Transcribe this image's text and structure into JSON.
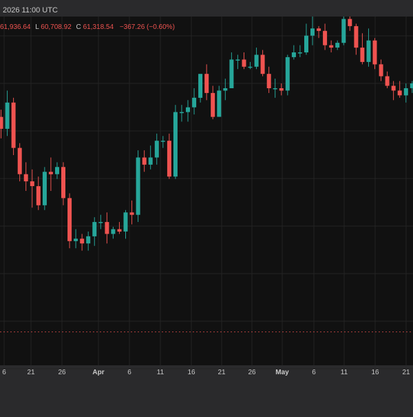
{
  "header": {
    "datetime": "2026 11:00 UTC",
    "ohlc_open": "61,936.64",
    "ohlc_low_label": "L",
    "ohlc_low": "60,708.92",
    "ohlc_close_label": "C",
    "ohlc_close": "61,318.54",
    "change": "−367.26 (−0.60%)"
  },
  "colors": {
    "background": "#111111",
    "frame": "#2a2a2c",
    "grid": "#242424",
    "up": "#26a69a",
    "down": "#ef5350",
    "axis_text": "#c9c9c9",
    "header_text": "#c9c9c9",
    "price_line": "#ef5350"
  },
  "chart_data": {
    "type": "candlestick",
    "x_tick_labels": [
      "6",
      "21",
      "26",
      "Apr",
      "6",
      "11",
      "16",
      "21",
      "26",
      "May",
      "6",
      "11",
      "16",
      "21"
    ],
    "y_range": [
      56200,
      70800
    ],
    "grid": true,
    "last_price_line": 57600,
    "candles": [
      {
        "d": "Mar 16",
        "o": 66600,
        "h": 66900,
        "l": 65700,
        "c": 66100
      },
      {
        "d": "Mar 17",
        "o": 66100,
        "h": 67700,
        "l": 65800,
        "c": 67200
      },
      {
        "d": "Mar 18",
        "o": 67200,
        "h": 67400,
        "l": 65000,
        "c": 65300
      },
      {
        "d": "Mar 19",
        "o": 65300,
        "h": 65500,
        "l": 63900,
        "c": 64200
      },
      {
        "d": "Mar 20",
        "o": 64200,
        "h": 64700,
        "l": 63500,
        "c": 63900
      },
      {
        "d": "Mar 21",
        "o": 63900,
        "h": 64400,
        "l": 62800,
        "c": 63700
      },
      {
        "d": "Mar 22",
        "o": 63700,
        "h": 64100,
        "l": 62700,
        "c": 62900
      },
      {
        "d": "Mar 23",
        "o": 62900,
        "h": 64500,
        "l": 62700,
        "c": 64300
      },
      {
        "d": "Mar 24",
        "o": 64300,
        "h": 64900,
        "l": 63500,
        "c": 64200
      },
      {
        "d": "Mar 25",
        "o": 64200,
        "h": 64700,
        "l": 64000,
        "c": 64500
      },
      {
        "d": "Mar 26",
        "o": 64500,
        "h": 64700,
        "l": 62900,
        "c": 63200
      },
      {
        "d": "Mar 27",
        "o": 63200,
        "h": 63400,
        "l": 61100,
        "c": 61400
      },
      {
        "d": "Mar 28",
        "o": 61400,
        "h": 61900,
        "l": 61100,
        "c": 61500
      },
      {
        "d": "Mar 29",
        "o": 61500,
        "h": 61700,
        "l": 61000,
        "c": 61300
      },
      {
        "d": "Mar 30",
        "o": 61300,
        "h": 61800,
        "l": 61000,
        "c": 61600
      },
      {
        "d": "Mar 31",
        "o": 61600,
        "h": 62400,
        "l": 61200,
        "c": 62200
      },
      {
        "d": "Apr 1",
        "o": 62200,
        "h": 62500,
        "l": 61900,
        "c": 62200
      },
      {
        "d": "Apr 2",
        "o": 62200,
        "h": 62600,
        "l": 61300,
        "c": 61700
      },
      {
        "d": "Apr 3",
        "o": 61700,
        "h": 62000,
        "l": 61500,
        "c": 61900
      },
      {
        "d": "Apr 4",
        "o": 61900,
        "h": 62200,
        "l": 61700,
        "c": 61800
      },
      {
        "d": "Apr 5",
        "o": 61800,
        "h": 62700,
        "l": 61500,
        "c": 62600
      },
      {
        "d": "Apr 6",
        "o": 62600,
        "h": 63100,
        "l": 62100,
        "c": 62500
      },
      {
        "d": "Apr 7",
        "o": 62500,
        "h": 65200,
        "l": 62200,
        "c": 64900
      },
      {
        "d": "Apr 8",
        "o": 64900,
        "h": 65200,
        "l": 64300,
        "c": 64600
      },
      {
        "d": "Apr 9",
        "o": 64600,
        "h": 65400,
        "l": 64400,
        "c": 64900
      },
      {
        "d": "Apr 10",
        "o": 64900,
        "h": 65900,
        "l": 64600,
        "c": 65600
      },
      {
        "d": "Apr 11",
        "o": 65600,
        "h": 65800,
        "l": 65300,
        "c": 65600
      },
      {
        "d": "Apr 12",
        "o": 65600,
        "h": 65900,
        "l": 64000,
        "c": 64100
      },
      {
        "d": "Apr 13",
        "o": 64100,
        "h": 67100,
        "l": 64000,
        "c": 66800
      },
      {
        "d": "Apr 14",
        "o": 66800,
        "h": 67100,
        "l": 66400,
        "c": 66800
      },
      {
        "d": "Apr 15",
        "o": 66800,
        "h": 67300,
        "l": 66400,
        "c": 67000
      },
      {
        "d": "Apr 16",
        "o": 67000,
        "h": 67800,
        "l": 66700,
        "c": 67400
      },
      {
        "d": "Apr 17",
        "o": 67400,
        "h": 68200,
        "l": 67200,
        "c": 68400
      },
      {
        "d": "Apr 18",
        "o": 68400,
        "h": 68800,
        "l": 67300,
        "c": 67600
      },
      {
        "d": "Apr 19",
        "o": 67600,
        "h": 67900,
        "l": 66500,
        "c": 66600
      },
      {
        "d": "Apr 20",
        "o": 66600,
        "h": 67900,
        "l": 66600,
        "c": 67700
      },
      {
        "d": "Apr 21",
        "o": 67700,
        "h": 68200,
        "l": 67300,
        "c": 67800
      },
      {
        "d": "Apr 22",
        "o": 67800,
        "h": 69300,
        "l": 67800,
        "c": 69000
      },
      {
        "d": "Apr 23",
        "o": 69000,
        "h": 69200,
        "l": 68600,
        "c": 69000
      },
      {
        "d": "Apr 24",
        "o": 69000,
        "h": 69300,
        "l": 68600,
        "c": 68700
      },
      {
        "d": "Apr 25",
        "o": 68700,
        "h": 68900,
        "l": 68600,
        "c": 68700
      },
      {
        "d": "Apr 26",
        "o": 68700,
        "h": 69500,
        "l": 68600,
        "c": 69200
      },
      {
        "d": "Apr 27",
        "o": 69200,
        "h": 69400,
        "l": 68300,
        "c": 68400
      },
      {
        "d": "Apr 28",
        "o": 68400,
        "h": 68700,
        "l": 67600,
        "c": 67800
      },
      {
        "d": "Apr 29",
        "o": 67800,
        "h": 68200,
        "l": 67400,
        "c": 67800
      },
      {
        "d": "Apr 30",
        "o": 67800,
        "h": 68000,
        "l": 67500,
        "c": 67700
      },
      {
        "d": "May 1",
        "o": 67700,
        "h": 69200,
        "l": 67500,
        "c": 69100
      },
      {
        "d": "May 2",
        "o": 69100,
        "h": 69600,
        "l": 69000,
        "c": 69300
      },
      {
        "d": "May 3",
        "o": 69300,
        "h": 69600,
        "l": 69100,
        "c": 69300
      },
      {
        "d": "May 4",
        "o": 69300,
        "h": 70500,
        "l": 69200,
        "c": 70000
      },
      {
        "d": "May 5",
        "o": 70000,
        "h": 70800,
        "l": 69600,
        "c": 70300
      },
      {
        "d": "May 6",
        "o": 70300,
        "h": 70400,
        "l": 69900,
        "c": 70200
      },
      {
        "d": "May 7",
        "o": 70200,
        "h": 70500,
        "l": 69400,
        "c": 69600
      },
      {
        "d": "May 8",
        "o": 69600,
        "h": 69800,
        "l": 69300,
        "c": 69500
      },
      {
        "d": "May 9",
        "o": 69500,
        "h": 69800,
        "l": 69400,
        "c": 69700
      },
      {
        "d": "May 10",
        "o": 69700,
        "h": 70800,
        "l": 69600,
        "c": 70700
      },
      {
        "d": "May 11",
        "o": 70700,
        "h": 70800,
        "l": 70200,
        "c": 70400
      },
      {
        "d": "May 12",
        "o": 70400,
        "h": 70500,
        "l": 69200,
        "c": 69500
      },
      {
        "d": "May 13",
        "o": 69500,
        "h": 70100,
        "l": 68800,
        "c": 68900
      },
      {
        "d": "May 14",
        "o": 68900,
        "h": 70300,
        "l": 68700,
        "c": 69800
      },
      {
        "d": "May 15",
        "o": 69800,
        "h": 69900,
        "l": 68600,
        "c": 68800
      },
      {
        "d": "May 16",
        "o": 68800,
        "h": 69000,
        "l": 68100,
        "c": 68300
      },
      {
        "d": "May 17",
        "o": 68300,
        "h": 68500,
        "l": 67800,
        "c": 67900
      },
      {
        "d": "May 18",
        "o": 67900,
        "h": 68100,
        "l": 67300,
        "c": 67700
      },
      {
        "d": "May 19",
        "o": 67700,
        "h": 68100,
        "l": 67400,
        "c": 67500
      },
      {
        "d": "May 20",
        "o": 67500,
        "h": 68000,
        "l": 67200,
        "c": 67800
      },
      {
        "d": "May 21",
        "o": 67800,
        "h": 68100,
        "l": 67600,
        "c": 68000
      },
      {
        "d": "May 22",
        "o": 68000,
        "h": 68200,
        "l": 67000,
        "c": 67200
      }
    ]
  }
}
